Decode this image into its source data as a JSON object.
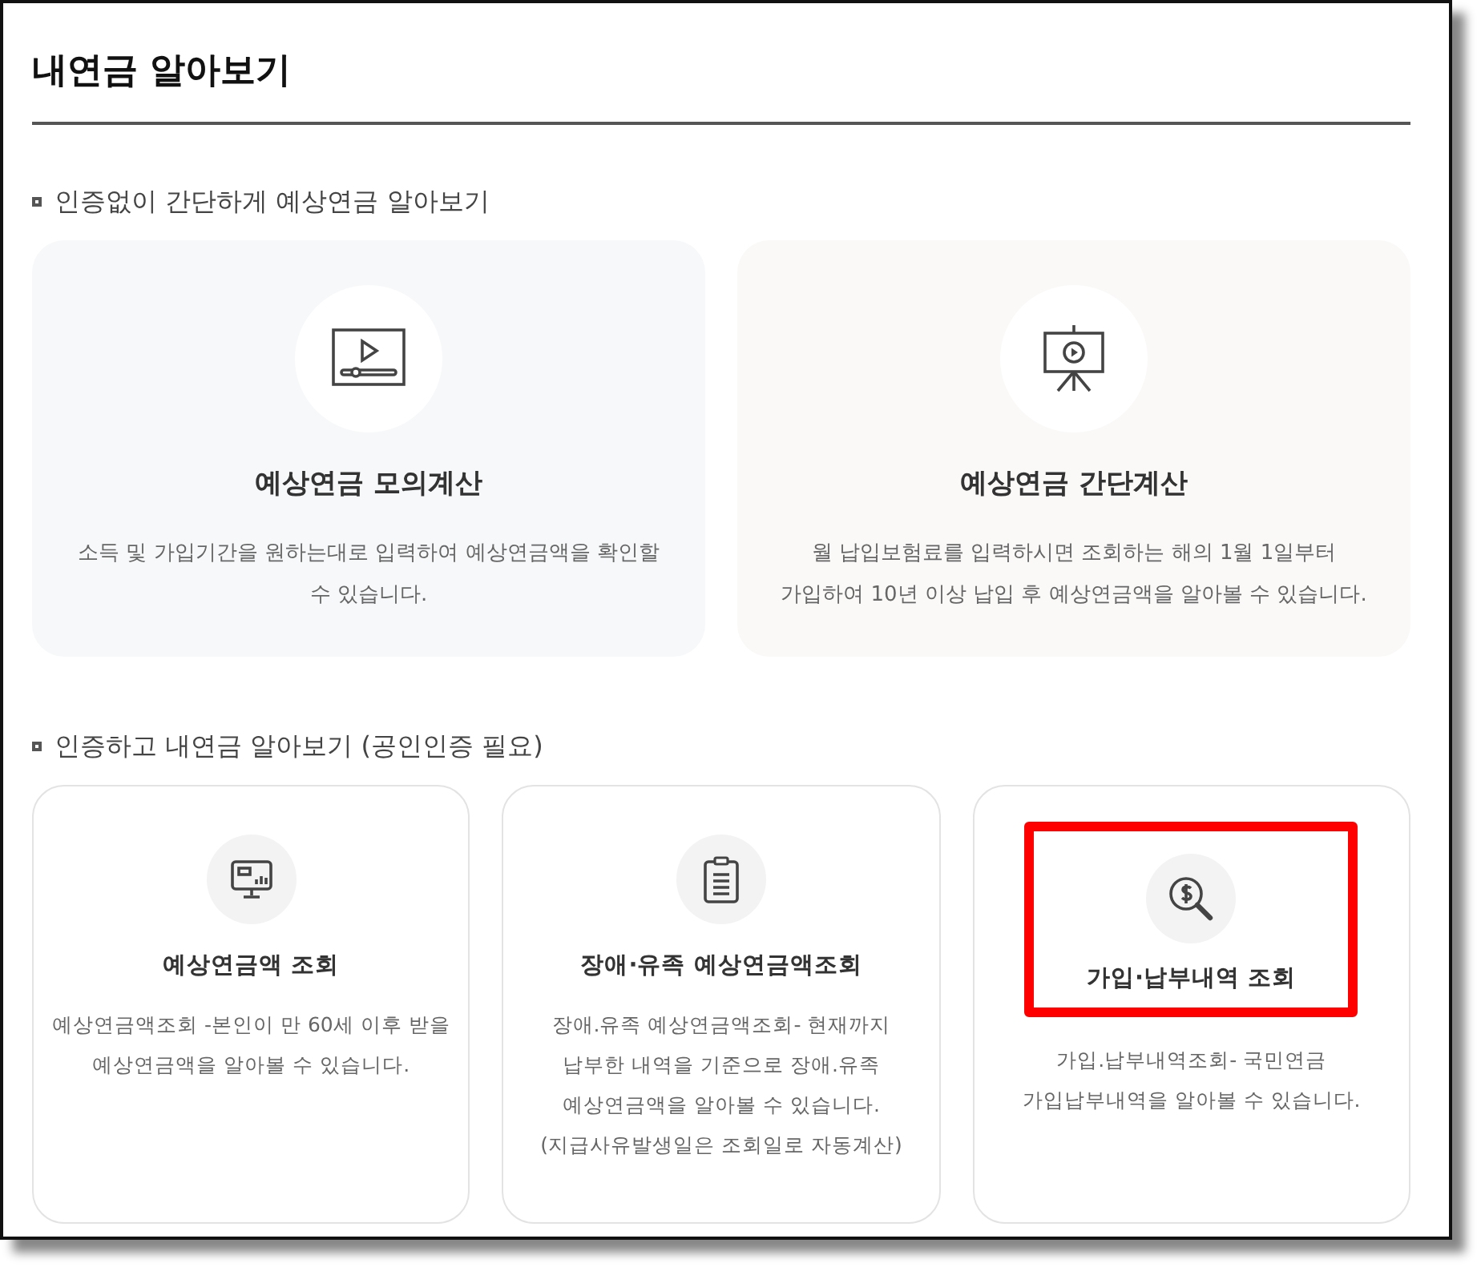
{
  "title": "내연금 알아보기",
  "sections": [
    {
      "heading": "인증없이 간단하게 예상연금 알아보기",
      "cards": [
        {
          "title": "예상연금 모의계산",
          "highlighted": false,
          "lines": [
            "소득 및 가입기간을 원하는대로 입력하여 예상연금액을 확인할",
            "수 있습니다."
          ]
        },
        {
          "title": "예상연금 간단계산",
          "highlighted": false,
          "lines": [
            "월 납입보험료를 입력하시면 조회하는 해의 1월 1일부터",
            "가입하여 10년 이상 납입 후 예상연금액을 알아볼 수 있습니다."
          ]
        }
      ]
    },
    {
      "heading": "인증하고 내연금 알아보기 (공인인증 필요)",
      "cards": [
        {
          "title": "예상연금액 조회",
          "highlighted": false,
          "lines": [
            "예상연금액조회 -본인이 만 60세 이후 받을",
            "예상연금액을 알아볼 수 있습니다."
          ]
        },
        {
          "title": "장애·유족 예상연금액조회",
          "highlighted": false,
          "lines": [
            "장애.유족 예상연금액조회- 현재까지",
            "납부한 내역을 기준으로 장애.유족",
            "예상연금액을 알아볼 수 있습니다.",
            "(지급사유발생일은 조회일로 자동계산)"
          ]
        },
        {
          "title": "가입·납부내역 조회",
          "highlighted": true,
          "lines": [
            "가입.납부내역조회- 국민연금",
            "가입납부내역을 알아볼 수 있습니다."
          ]
        }
      ]
    }
  ]
}
